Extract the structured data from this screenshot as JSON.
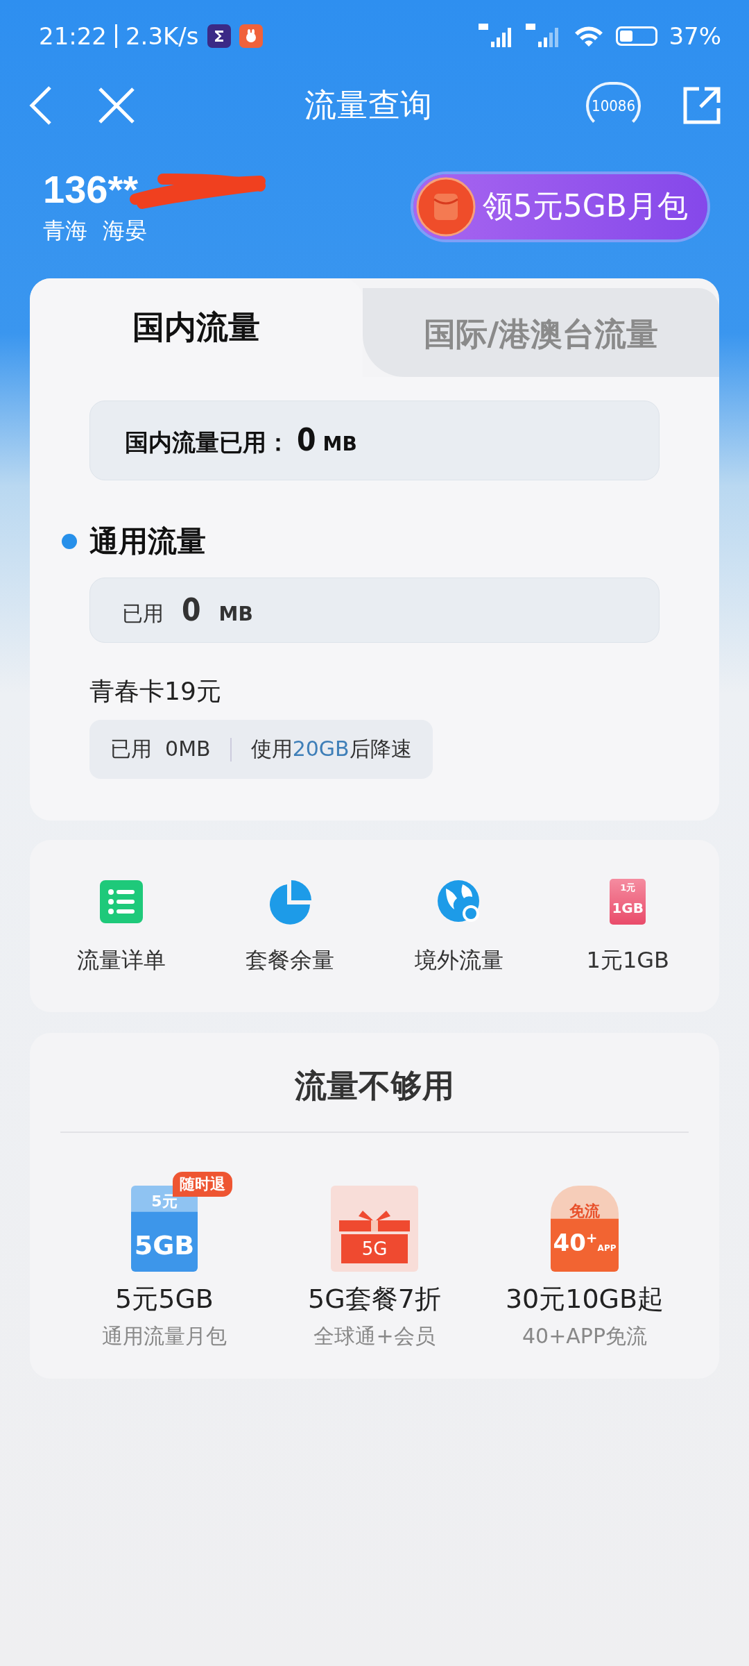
{
  "status_bar": {
    "time": "21:22",
    "speed": "2.3K/s",
    "battery": "37%"
  },
  "nav": {
    "title": "流量查询",
    "hotline": "10086"
  },
  "account": {
    "phone": "136**",
    "region": [
      "青海",
      "海晏"
    ],
    "promo": "领5元5GB月包"
  },
  "tabs": [
    {
      "label": "国内流量",
      "selected": true
    },
    {
      "label": "国际/港澳台流量",
      "selected": false
    }
  ],
  "domestic": {
    "label": "国内流量已用：",
    "value": "0",
    "unit": "MB"
  },
  "general": {
    "title": "通用流量",
    "used_label": "已用",
    "value": "0",
    "unit": "MB"
  },
  "plan": {
    "name": "青春卡19元",
    "used": "已用  0MB",
    "limit_parts": [
      "使用",
      "20GB",
      "后降速"
    ]
  },
  "shortcuts": [
    {
      "kind": "list",
      "label": "流量详单"
    },
    {
      "kind": "pie",
      "label": "套餐余量"
    },
    {
      "kind": "globe",
      "label": "境外流量"
    },
    {
      "kind": "card",
      "label": "1元1GB",
      "art": [
        "1元",
        "1GB"
      ]
    }
  ],
  "offers": {
    "title": "流量不够用",
    "items": [
      {
        "kind": "blue",
        "title": "5元5GB",
        "subtitle": "通用流量月包",
        "badge": "随时退",
        "art": [
          "5元",
          "5GB"
        ]
      },
      {
        "kind": "gift",
        "title": "5G套餐7折",
        "subtitle": "全球通+会员",
        "art": [
          "5G"
        ]
      },
      {
        "kind": "orange",
        "title": "30元10GB起",
        "subtitle": "40+APP免流",
        "art": [
          "免流",
          "40",
          "+",
          "APP"
        ]
      }
    ]
  }
}
